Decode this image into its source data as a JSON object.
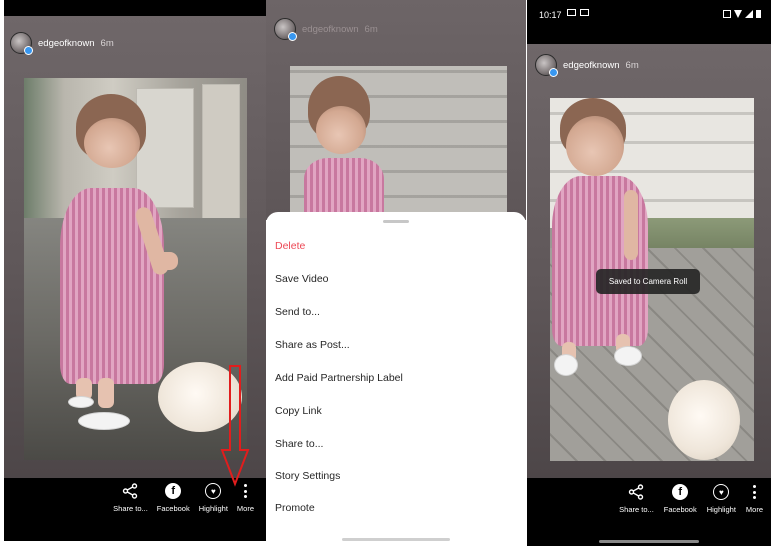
{
  "panel1": {
    "username": "edgeofknown",
    "time": "6m",
    "actions": [
      {
        "label": "Share to...",
        "icon": "share-icon"
      },
      {
        "label": "Facebook",
        "icon": "facebook-icon"
      },
      {
        "label": "Highlight",
        "icon": "highlight-heart-icon"
      },
      {
        "label": "More",
        "icon": "more-vertical-icon"
      }
    ],
    "annotation_color": "#e11d1d"
  },
  "panel2": {
    "username": "edgeofknown",
    "time": "6m",
    "menu": [
      {
        "label": "Delete",
        "danger": true
      },
      {
        "label": "Save Video"
      },
      {
        "label": "Send to..."
      },
      {
        "label": "Share as Post..."
      },
      {
        "label": "Add Paid Partnership Label"
      },
      {
        "label": "Copy Link"
      },
      {
        "label": "Share to..."
      },
      {
        "label": "Story Settings"
      },
      {
        "label": "Promote"
      }
    ],
    "danger_color": "#ed4956"
  },
  "panel3": {
    "status_time": "10:17",
    "username": "edgeofknown",
    "time": "6m",
    "toast": "Saved to Camera Roll",
    "actions": [
      {
        "label": "Share to...",
        "icon": "share-icon"
      },
      {
        "label": "Facebook",
        "icon": "facebook-icon"
      },
      {
        "label": "Highlight",
        "icon": "highlight-heart-icon"
      },
      {
        "label": "More",
        "icon": "more-vertical-icon"
      }
    ]
  },
  "colors": {
    "story_bg": "#6f6769",
    "accent_blue": "#3897f0"
  }
}
